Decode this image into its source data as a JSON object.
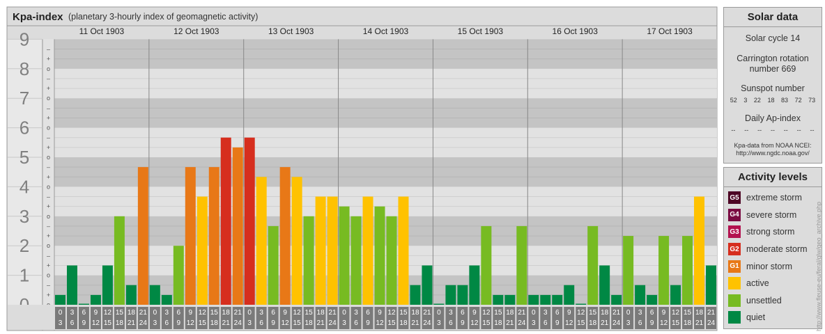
{
  "chart_data": {
    "type": "bar",
    "title": "Kpa-index",
    "subtitle": "(planetary 3-hourly index of geomagnetic activity)",
    "ylim": [
      0,
      9
    ],
    "y_ticks": [
      "0",
      "1",
      "2",
      "3",
      "4",
      "5",
      "6",
      "7",
      "8",
      "9"
    ],
    "minor_tick_marks": [
      "o",
      "+",
      "–"
    ],
    "days": [
      "11 Oct 1903",
      "12 Oct 1903",
      "13 Oct 1903",
      "14 Oct 1903",
      "15 Oct 1903",
      "16 Oct 1903",
      "17 Oct 1903"
    ],
    "interval_labels": [
      [
        "0",
        "3"
      ],
      [
        "3",
        "6"
      ],
      [
        "6",
        "9"
      ],
      [
        "9",
        "12"
      ],
      [
        "12",
        "15"
      ],
      [
        "15",
        "18"
      ],
      [
        "18",
        "21"
      ],
      [
        "21",
        "24"
      ]
    ],
    "values": [
      0.333,
      1.333,
      0,
      0.333,
      1.333,
      3,
      0.667,
      4.667,
      0.667,
      0.333,
      2,
      4.667,
      3.667,
      4.667,
      5.667,
      5.333,
      5.667,
      4.333,
      2.667,
      4.667,
      4.333,
      3,
      3.667,
      3.667,
      3.333,
      3,
      3.667,
      3.333,
      3,
      3.667,
      0.667,
      1.333,
      0,
      0.667,
      0.667,
      1.333,
      2.667,
      0.333,
      0.333,
      2.667,
      0.333,
      0.333,
      0.333,
      0.667,
      0,
      2.667,
      1.333,
      0.333,
      2.333,
      0.667,
      0.333,
      2.333,
      0.667,
      2.333,
      3.667,
      1.333
    ],
    "level_colors": {
      "quiet": "#008844",
      "unsettled": "#77bb22",
      "active": "#ffc200",
      "G1": "#e87817",
      "G2": "#d62e1e",
      "G3": "#b3124f",
      "G4": "#7a0a41",
      "G5": "#4d0524"
    }
  },
  "solar_data": {
    "title": "Solar data",
    "solar_cycle": "Solar cycle 14",
    "carrington_line1": "Carrington rotation",
    "carrington_line2": "number 669",
    "sunspot_label": "Sunspot number",
    "sunspot_values": [
      "52",
      "3",
      "22",
      "18",
      "83",
      "72",
      "73"
    ],
    "ap_label": "Daily Ap-index",
    "ap_values": [
      "--",
      "--",
      "--",
      "--",
      "--",
      "--",
      "--"
    ],
    "source_line1": "Kpa-data from NOAA NCEI:",
    "source_line2": "http://www.ngdc.noaa.gov/"
  },
  "activity_levels": {
    "title": "Activity levels",
    "items": [
      {
        "badge": "G5",
        "label": "extreme storm",
        "color": "#4d0524"
      },
      {
        "badge": "G4",
        "label": "severe storm",
        "color": "#7a0a41"
      },
      {
        "badge": "G3",
        "label": "strong storm",
        "color": "#b3124f"
      },
      {
        "badge": "G2",
        "label": "moderate storm",
        "color": "#d62e1e"
      },
      {
        "badge": "G1",
        "label": "minor storm",
        "color": "#e87817"
      },
      {
        "badge": "",
        "label": "active",
        "color": "#ffc200"
      },
      {
        "badge": "",
        "label": "unsettled",
        "color": "#77bb22"
      },
      {
        "badge": "",
        "label": "quiet",
        "color": "#008844"
      }
    ]
  },
  "credit": "http://www.fleuse-eu/feral/glw/geo_archive.php"
}
